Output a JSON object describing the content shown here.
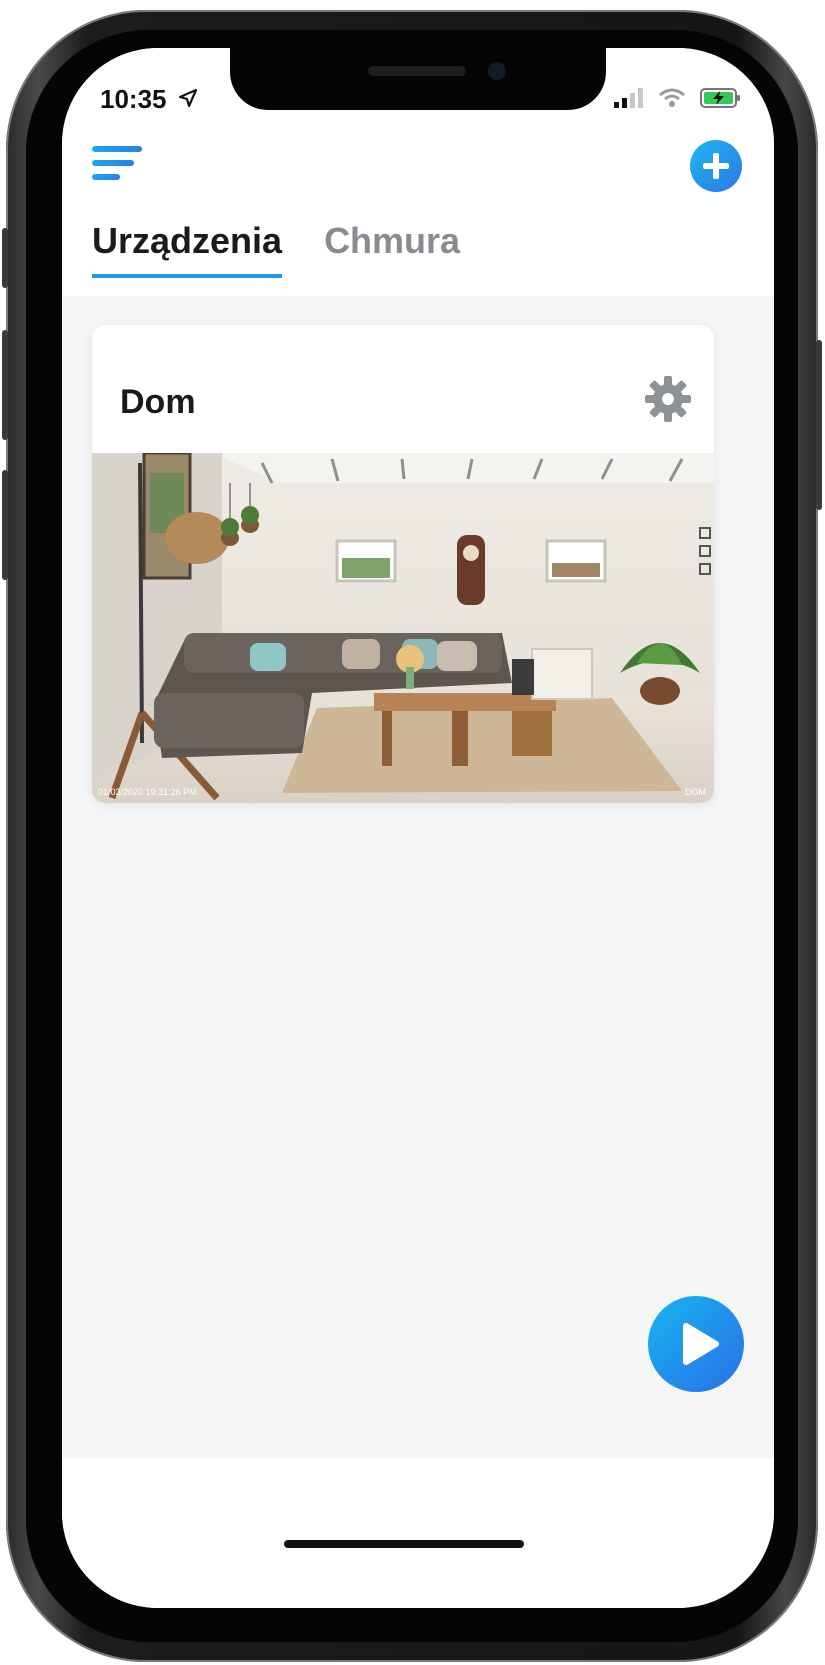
{
  "status_bar": {
    "time": "10:35",
    "location_icon": "location-arrow-icon",
    "signal_icon": "signal-icon",
    "wifi_icon": "wifi-icon",
    "battery_icon": "battery-charging-icon"
  },
  "header": {
    "menu_icon": "menu-icon",
    "add_icon": "add-circle-icon"
  },
  "tabs": [
    {
      "label": "Urządzenia",
      "active": true
    },
    {
      "label": "Chmura",
      "active": false
    }
  ],
  "devices": [
    {
      "name": "Dom",
      "settings_icon": "gear-icon",
      "preview_timestamp": "01/03/2020 19:31:26 PM",
      "preview_label": "DOM"
    }
  ],
  "fab": {
    "icon": "play-icon"
  },
  "colors": {
    "accent": "#1e98e6",
    "background": "#f4f6f8",
    "text_primary": "#1a1a1a",
    "text_inactive": "#888c90"
  }
}
